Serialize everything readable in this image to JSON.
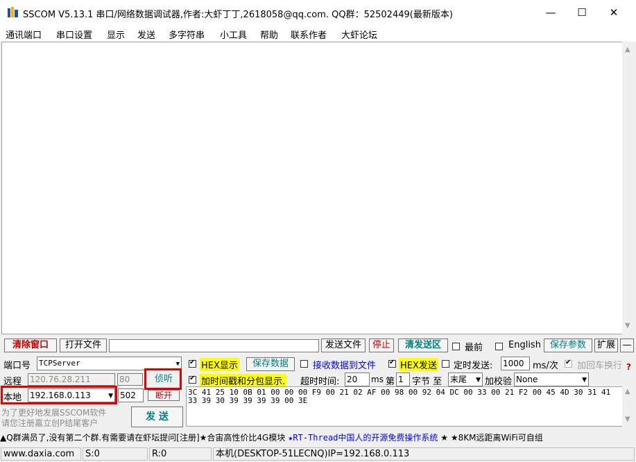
{
  "window": {
    "title": "SSCOM V5.13.1 串口/网络数据调试器,作者:大虾丁丁,2618058@qq.com. QQ群：52502449(最新版本)",
    "minimize": "—",
    "maximize": "☐",
    "close": "✕"
  },
  "menu": [
    "通讯端口",
    "串口设置",
    "显示",
    "发送",
    "多字符串",
    "小工具",
    "帮助",
    "联系作者",
    "大虾论坛"
  ],
  "toolbar": {
    "clear_window": "清除窗口",
    "open_file": "打开文件",
    "file_path": "",
    "send_file": "发送文件",
    "stop": "停止",
    "clear_send": "清发送区",
    "front": "最前",
    "english": "English",
    "save_params": "保存参数",
    "expand": "扩展",
    "collapse": "—"
  },
  "net": {
    "port_label": "端口号",
    "port_type": "TCPServer",
    "remote_label": "远程",
    "remote_ip": "120.76.28.211",
    "remote_port": "80",
    "listen": "侦听",
    "local_label": "本地",
    "local_ip": "192.168.0.113",
    "local_port": "502",
    "disconnect": "断开"
  },
  "options": {
    "hex_display": "HEX显示",
    "save_data": "保存数据",
    "recv_to_file": "接收数据到文件",
    "hex_send": "HEX发送",
    "timed_send": "定时发送:",
    "interval": "1000",
    "interval_unit": "ms/次",
    "add_crlf": "加回车换行",
    "timestamp": "加时间戳和分包显示.",
    "timeout_label": "超时时间:",
    "timeout": "20",
    "timeout_unit": "ms",
    "nth_label": "第",
    "nth": "1",
    "byte_to": "字节 至",
    "end": "末尾",
    "checksum_label": "加校验",
    "checksum": "None"
  },
  "promo": {
    "line1": "为了更好地发展SSCOM软件",
    "line2": "请您注册嘉立创P结尾客户"
  },
  "send_button": "发 送",
  "send_content": "3C 41 25 10 0B 01 00 00 00 F9 00 21 02 AF 00 98 00 92 04 DC 00 33 00 21 F2 00 45 4D 30 31 41 33 39 30 39 39 39 39 00 3E",
  "marquee": {
    "part1": "▲Q群满员了,没有第二个群.有需要请在虾坛提问[注册]★合宙高性价比4G模块 ",
    "part2": "★RT-Thread中国人的开源免费操作系统",
    "part3": " ★ ★8KM远距离WiFi可自组"
  },
  "status": {
    "website": "www.daxia.com",
    "sent": "S:0",
    "received": "R:0",
    "host": "本机(DESKTOP-51LECNQ)IP=192.168.0.113"
  },
  "colors": {
    "highlight_red": "#e00000",
    "hex_yellow": "#ffff00",
    "accent_teal": "#008080"
  }
}
